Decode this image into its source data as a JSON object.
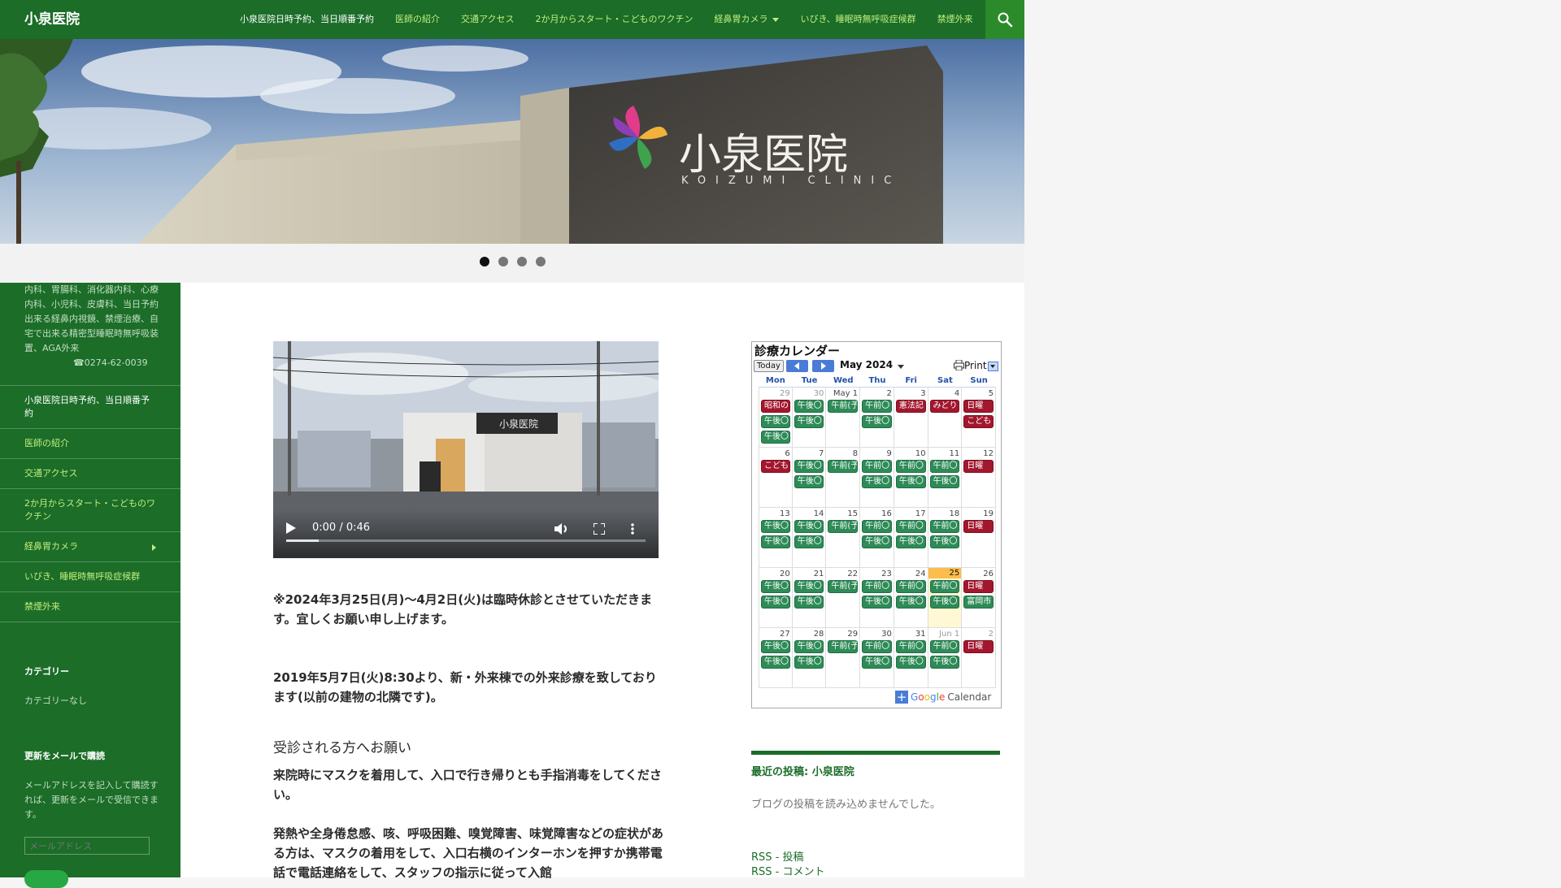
{
  "site": {
    "title": "小泉医院"
  },
  "nav": {
    "items": [
      {
        "label": "小泉医院日時予約、当日順番予約",
        "has_caret": false
      },
      {
        "label": "医師の紹介",
        "has_caret": false
      },
      {
        "label": "交通アクセス",
        "has_caret": false
      },
      {
        "label": "2か月からスタート・こどものワクチン",
        "has_caret": false
      },
      {
        "label": "経鼻胃カメラ",
        "has_caret": true
      },
      {
        "label": "いびき、睡眠時無呼吸症候群",
        "has_caret": false
      },
      {
        "label": "禁煙外来",
        "has_caret": false
      }
    ],
    "search_icon": "search-icon"
  },
  "hero": {
    "sign_text": "小泉医院",
    "sign_subtext": "KOIZUMI CLINIC",
    "slides": 4,
    "active_slide": 1
  },
  "sidebar": {
    "description": "内科、胃腸科、消化器内科、心療内科、小児科、皮膚科、当日予約出来る経鼻内視鏡、禁煙治療、自宅で出来る精密型睡眠時無呼吸装置、AGA外来",
    "phone": "☎0274-62-0039",
    "menu": [
      {
        "label": "小泉医院日時予約、当日順番予約",
        "has_arrow": false
      },
      {
        "label": "医師の紹介",
        "has_arrow": false
      },
      {
        "label": "交通アクセス",
        "has_arrow": false
      },
      {
        "label": "2か月からスタート・こどものワクチン",
        "has_arrow": false
      },
      {
        "label": "経鼻胃カメラ",
        "has_arrow": true
      },
      {
        "label": "いびき、睡眠時無呼吸症候群",
        "has_arrow": false
      },
      {
        "label": "禁煙外来",
        "has_arrow": false
      }
    ],
    "category_heading": "カテゴリー",
    "category_value": "カテゴリーなし",
    "subscribe_heading": "更新をメールで購読",
    "subscribe_text": "メールアドレスを記入して購読すれば、更新をメールで受信できます。",
    "email_placeholder": "メールアドレス"
  },
  "video": {
    "time": "0:00 / 0:46",
    "progress": 0.09
  },
  "content": {
    "notice_1": "※2024年3月25日(月)〜4月2日(火)は臨時休診とさせていただきます。宜しくお願い申し上げます。",
    "notice_2": "2019年5月7日(火)8:30より、新・外来棟での外来診療を致しております(以前の建物の北隣です)。",
    "heading": "受診される方へお願い",
    "para_1": "来院時にマスクを着用して、入口で行き帰りとも手指消毒をしてください。",
    "para_2": "発熱や全身倦怠感、咳、呼吸困難、嗅覚障害、味覚障害などの症状がある方は、マスクの着用をして、入口右横のインターホンを押すか携帯電話で電話連絡をして、スタッフの指示に従って入館"
  },
  "calendar": {
    "title": "診療カレンダー",
    "today_label": "Today",
    "month": "May 2024",
    "print_label": "Print",
    "days_of_week": [
      "Mon",
      "Tue",
      "Wed",
      "Thu",
      "Fri",
      "Sat",
      "Sun"
    ],
    "footer": {
      "google": "Google",
      "calendar": "Calendar"
    },
    "weeks": [
      [
        {
          "n": "29",
          "other": true,
          "events": [
            {
              "t": "昭和の",
              "c": "r"
            },
            {
              "t": "午後〇",
              "c": "g"
            },
            {
              "t": "午後〇",
              "c": "g"
            }
          ]
        },
        {
          "n": "30",
          "other": true,
          "events": [
            {
              "t": "午後〇",
              "c": "g"
            },
            {
              "t": "午後〇",
              "c": "g"
            }
          ]
        },
        {
          "n": "May 1",
          "other": false,
          "events": [
            {
              "t": "午前(予",
              "c": "g"
            }
          ]
        },
        {
          "n": "2",
          "other": false,
          "events": [
            {
              "t": "午前〇",
              "c": "g"
            },
            {
              "t": "午後〇",
              "c": "g"
            }
          ]
        },
        {
          "n": "3",
          "other": false,
          "events": [
            {
              "t": "憲法記",
              "c": "r"
            }
          ]
        },
        {
          "n": "4",
          "other": false,
          "events": [
            {
              "t": "みどり",
              "c": "r"
            }
          ]
        },
        {
          "n": "5",
          "other": false,
          "events": [
            {
              "t": "日曜",
              "c": "r"
            },
            {
              "t": "こども",
              "c": "r"
            }
          ]
        }
      ],
      [
        {
          "n": "6",
          "other": false,
          "events": [
            {
              "t": "こども",
              "c": "r"
            }
          ]
        },
        {
          "n": "7",
          "other": false,
          "events": [
            {
              "t": "午後〇",
              "c": "g"
            },
            {
              "t": "午後〇",
              "c": "g"
            }
          ]
        },
        {
          "n": "8",
          "other": false,
          "events": [
            {
              "t": "午前(予",
              "c": "g"
            }
          ]
        },
        {
          "n": "9",
          "other": false,
          "events": [
            {
              "t": "午前〇",
              "c": "g"
            },
            {
              "t": "午後〇",
              "c": "g"
            }
          ]
        },
        {
          "n": "10",
          "other": false,
          "events": [
            {
              "t": "午前〇",
              "c": "g"
            },
            {
              "t": "午後〇",
              "c": "g"
            }
          ]
        },
        {
          "n": "11",
          "other": false,
          "events": [
            {
              "t": "午前〇",
              "c": "g"
            },
            {
              "t": "午後〇",
              "c": "g"
            }
          ]
        },
        {
          "n": "12",
          "other": false,
          "events": [
            {
              "t": "日曜",
              "c": "r"
            }
          ]
        }
      ],
      [
        {
          "n": "13",
          "other": false,
          "events": [
            {
              "t": "午後〇",
              "c": "g"
            },
            {
              "t": "午後〇",
              "c": "g"
            }
          ]
        },
        {
          "n": "14",
          "other": false,
          "events": [
            {
              "t": "午後〇",
              "c": "g"
            },
            {
              "t": "午後〇",
              "c": "g"
            }
          ]
        },
        {
          "n": "15",
          "other": false,
          "events": [
            {
              "t": "午前(予",
              "c": "g"
            }
          ]
        },
        {
          "n": "16",
          "other": false,
          "events": [
            {
              "t": "午前〇",
              "c": "g"
            },
            {
              "t": "午後〇",
              "c": "g"
            }
          ]
        },
        {
          "n": "17",
          "other": false,
          "events": [
            {
              "t": "午前〇",
              "c": "g"
            },
            {
              "t": "午後〇",
              "c": "g"
            }
          ]
        },
        {
          "n": "18",
          "other": false,
          "events": [
            {
              "t": "午前〇",
              "c": "g"
            },
            {
              "t": "午後〇",
              "c": "g"
            }
          ]
        },
        {
          "n": "19",
          "other": false,
          "events": [
            {
              "t": "日曜",
              "c": "r"
            }
          ]
        }
      ],
      [
        {
          "n": "20",
          "other": false,
          "events": [
            {
              "t": "午後〇",
              "c": "g"
            },
            {
              "t": "午後〇",
              "c": "g"
            }
          ]
        },
        {
          "n": "21",
          "other": false,
          "events": [
            {
              "t": "午後〇",
              "c": "g"
            },
            {
              "t": "午後〇",
              "c": "g"
            }
          ]
        },
        {
          "n": "22",
          "other": false,
          "events": [
            {
              "t": "午前(予",
              "c": "g"
            }
          ]
        },
        {
          "n": "23",
          "other": false,
          "events": [
            {
              "t": "午前〇",
              "c": "g"
            },
            {
              "t": "午後〇",
              "c": "g"
            }
          ]
        },
        {
          "n": "24",
          "other": false,
          "events": [
            {
              "t": "午前〇",
              "c": "g"
            },
            {
              "t": "午後〇",
              "c": "g"
            }
          ]
        },
        {
          "n": "25",
          "other": false,
          "today": true,
          "events": [
            {
              "t": "午前〇",
              "c": "g"
            },
            {
              "t": "午後〇",
              "c": "g"
            }
          ]
        },
        {
          "n": "26",
          "other": false,
          "events": [
            {
              "t": "日曜",
              "c": "r"
            },
            {
              "t": "富岡市",
              "c": "g"
            }
          ]
        }
      ],
      [
        {
          "n": "27",
          "other": false,
          "events": [
            {
              "t": "午後〇",
              "c": "g"
            },
            {
              "t": "午後〇",
              "c": "g"
            }
          ]
        },
        {
          "n": "28",
          "other": false,
          "events": [
            {
              "t": "午後〇",
              "c": "g"
            },
            {
              "t": "午後〇",
              "c": "g"
            }
          ]
        },
        {
          "n": "29",
          "other": false,
          "events": [
            {
              "t": "午前(予",
              "c": "g"
            }
          ]
        },
        {
          "n": "30",
          "other": false,
          "events": [
            {
              "t": "午前〇",
              "c": "g"
            },
            {
              "t": "午後〇",
              "c": "g"
            }
          ]
        },
        {
          "n": "31",
          "other": false,
          "events": [
            {
              "t": "午前〇",
              "c": "g"
            },
            {
              "t": "午後〇",
              "c": "g"
            }
          ]
        },
        {
          "n": "Jun 1",
          "other": true,
          "events": [
            {
              "t": "午前〇",
              "c": "g"
            },
            {
              "t": "午後〇",
              "c": "g"
            }
          ]
        },
        {
          "n": "2",
          "other": true,
          "events": [
            {
              "t": "日曜",
              "c": "r"
            }
          ]
        }
      ]
    ]
  },
  "recent": {
    "heading": "最近の投稿: 小泉医院",
    "text": "ブログの投稿を読み込めませんでした。",
    "rss_posts": "RSS - 投稿",
    "rss_comments": "RSS - コメント"
  }
}
